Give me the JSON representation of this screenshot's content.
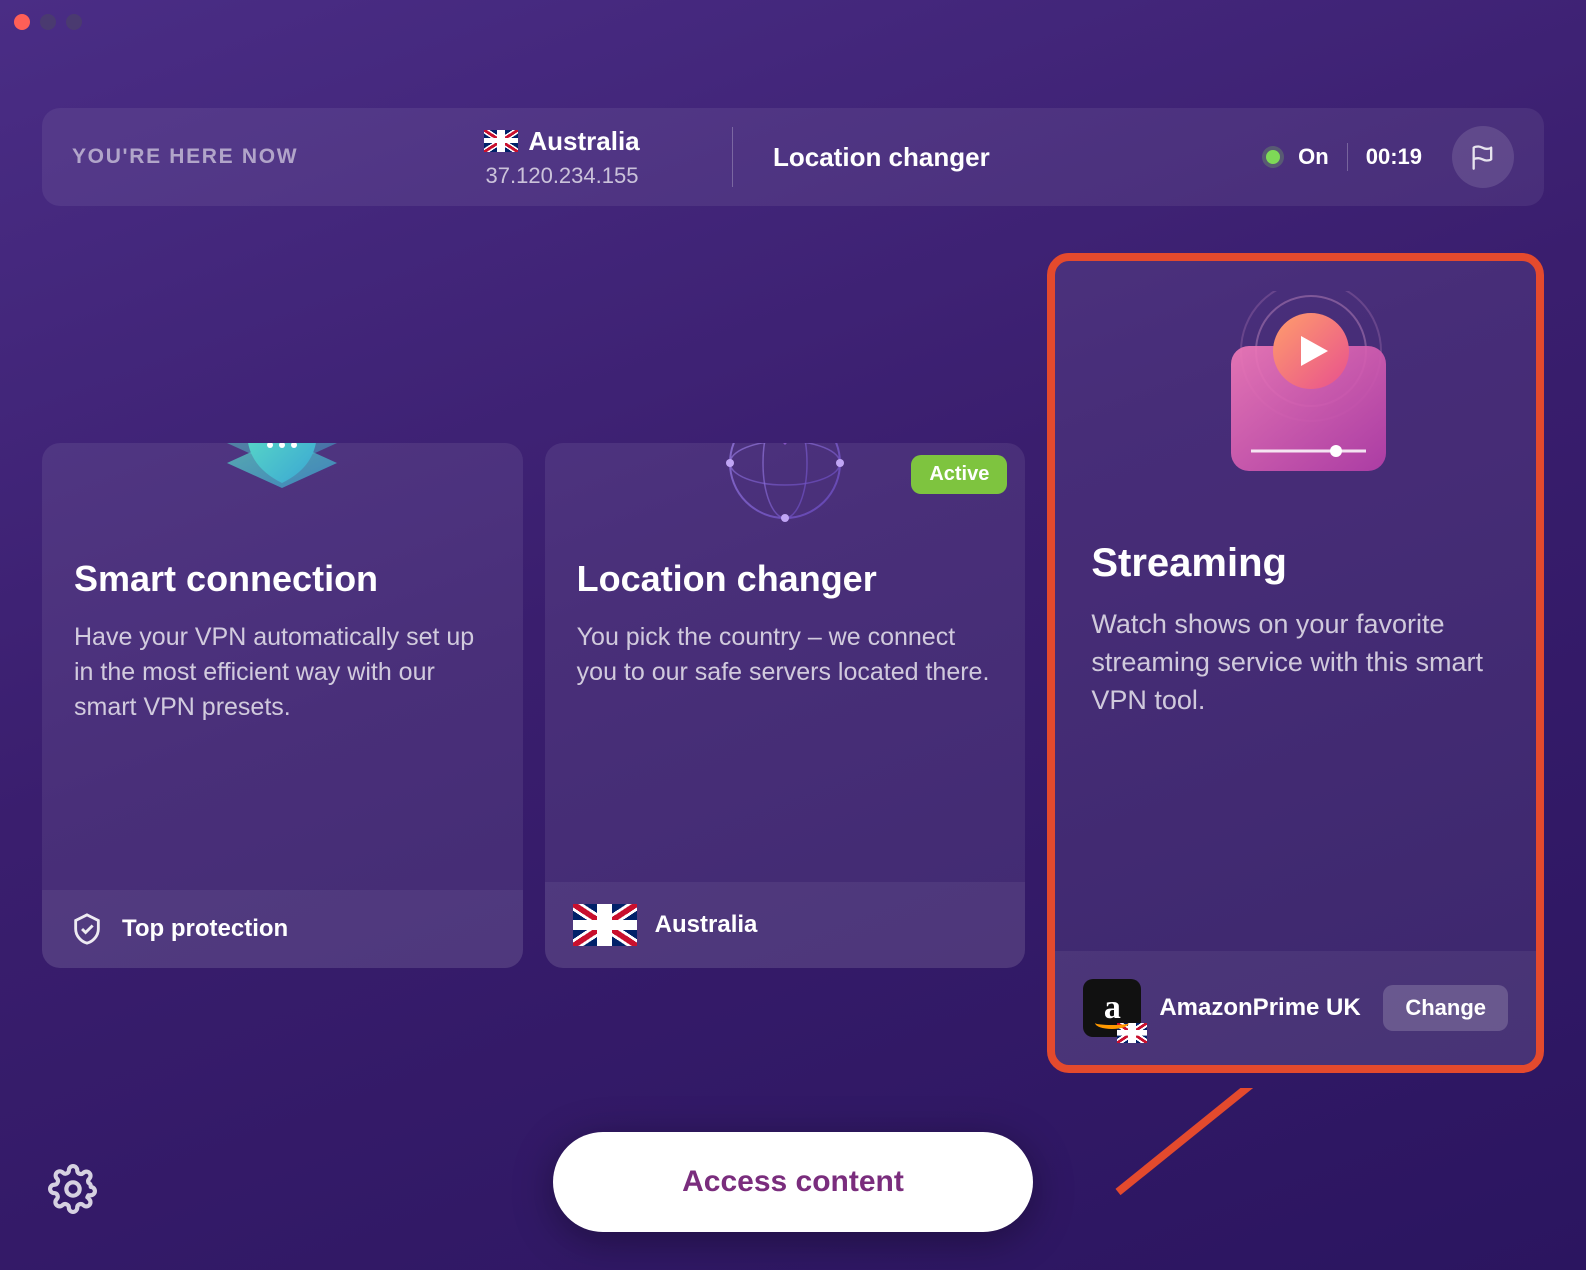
{
  "topbar": {
    "here_label": "YOU'RE HERE NOW",
    "country": "Australia",
    "ip": "37.120.234.155",
    "changer_label": "Location changer",
    "status_text": "On",
    "timer": "00:19"
  },
  "cards": {
    "smart": {
      "title": "Smart connection",
      "desc": "Have your VPN automatically set up in the most efficient way with our smart VPN presets.",
      "footer_label": "Top protection"
    },
    "location": {
      "title": "Location changer",
      "desc": "You pick the country – we connect you to our safe servers located there.",
      "active_badge": "Active",
      "footer_country": "Australia"
    },
    "streaming": {
      "title": "Streaming",
      "desc": "Watch shows on your favorite streaming service with this smart VPN tool.",
      "service_name": "AmazonPrime UK",
      "change_label": "Change"
    }
  },
  "access_button": "Access content"
}
